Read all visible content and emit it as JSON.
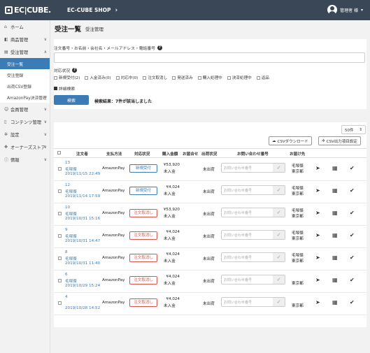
{
  "header": {
    "logo": "EC|CUBE.",
    "shop_name": "EC-CUBE SHOP",
    "user_name": "管理者 様"
  },
  "sidebar": {
    "items": [
      {
        "icon": "home-icon",
        "label": "ホーム"
      },
      {
        "icon": "box-icon",
        "label": "商品管理"
      },
      {
        "icon": "cart-icon",
        "label": "受注管理"
      }
    ],
    "sub": [
      "受注一覧",
      "受注登録",
      "出荷CSV登録",
      "AmazonPay決済管理"
    ],
    "items2": [
      {
        "icon": "users-icon",
        "label": "会員管理"
      },
      {
        "icon": "file-icon",
        "label": "コンテンツ管理"
      },
      {
        "icon": "gear-icon",
        "label": "設定"
      },
      {
        "icon": "puzzle-icon",
        "label": "オーナーズストア"
      },
      {
        "icon": "info-icon",
        "label": "情報"
      }
    ]
  },
  "page": {
    "title": "受注一覧",
    "breadcrumb": "受注管理"
  },
  "search": {
    "field_label": "注文番号・お名前・会社名・メールアドレス・電話番号",
    "value": "",
    "status_label": "対応状況",
    "statuses": [
      "新規受付(2)",
      "入金済み(0)",
      "対応中(0)",
      "注文取消し",
      "発送済み",
      "購入処理中",
      "決済処理中",
      "返品"
    ],
    "advanced": "詳細検索",
    "button": "検索",
    "result": "検索結果：7件が該当しました"
  },
  "table": {
    "page_size": "50件",
    "csv_download": "CSVダウンロード",
    "csv_settings": "CSV出力項目設定",
    "headers": [
      "注文者",
      "支払方法",
      "対応状況",
      "購入金額",
      "お届合せ",
      "出荷状況",
      "お問い合わせ番号",
      "お届け先"
    ],
    "inquiry_placeholder": "お問い合わせ番号",
    "rows": [
      {
        "no": "13",
        "name": "毛塚傑",
        "date": "2019/11/15 22:49",
        "payment": "AmazonPay",
        "status": "新規受付",
        "status_type": "new",
        "amount": "¥53,920",
        "pay_status": "未入金",
        "ship": "未出荷",
        "dest1": "毛塚傑",
        "dest2": "東京都"
      },
      {
        "no": "12",
        "name": "毛塚傑",
        "date": "2019/11/14 17:59",
        "payment": "AmazonPay",
        "status": "新規受付",
        "status_type": "new",
        "amount": "¥4,024",
        "pay_status": "未入金",
        "ship": "未出荷",
        "dest1": "毛塚傑",
        "dest2": "東京都"
      },
      {
        "no": "10",
        "name": "毛塚傑",
        "date": "2019/10/31 15:16",
        "payment": "AmazonPay",
        "status": "注文取消し",
        "status_type": "cancel",
        "amount": "¥53,920",
        "pay_status": "未入金",
        "ship": "未出荷",
        "dest1": "毛塚傑",
        "dest2": "東京都"
      },
      {
        "no": "9",
        "name": "毛塚傑",
        "date": "2019/10/31 14:47",
        "payment": "AmazonPay",
        "status": "注文取消し",
        "status_type": "cancel",
        "amount": "¥4,024",
        "pay_status": "未入金",
        "ship": "未出荷",
        "dest1": "毛塚傑",
        "dest2": "東京都"
      },
      {
        "no": "8",
        "name": "毛塚傑",
        "date": "2019/10/31 11:40",
        "payment": "AmazonPay",
        "status": "注文取消し",
        "status_type": "cancel",
        "amount": "¥4,024",
        "pay_status": "未入金",
        "ship": "未出荷",
        "dest1": "毛塚傑",
        "dest2": "東京都"
      },
      {
        "no": "6",
        "name": "毛塚傑",
        "date": "2019/10/29 15:24",
        "payment": "AmazonPay",
        "status": "注文取消し",
        "status_type": "cancel",
        "amount": "¥4,024",
        "pay_status": "未入金",
        "ship": "未出荷",
        "dest1": "",
        "dest2": "東京都"
      },
      {
        "no": "4",
        "name": "",
        "date": "2019/10/28 14:52",
        "payment": "AmazonPay",
        "status": "注文取消し",
        "status_type": "cancel",
        "amount": "¥4,024",
        "pay_status": "未入金",
        "ship": "未出荷",
        "dest1": "",
        "dest2": "東京都"
      }
    ]
  },
  "colors": {
    "topbar": "#3a4756",
    "accent": "#3b7bb6",
    "cancel": "#d9534f"
  }
}
